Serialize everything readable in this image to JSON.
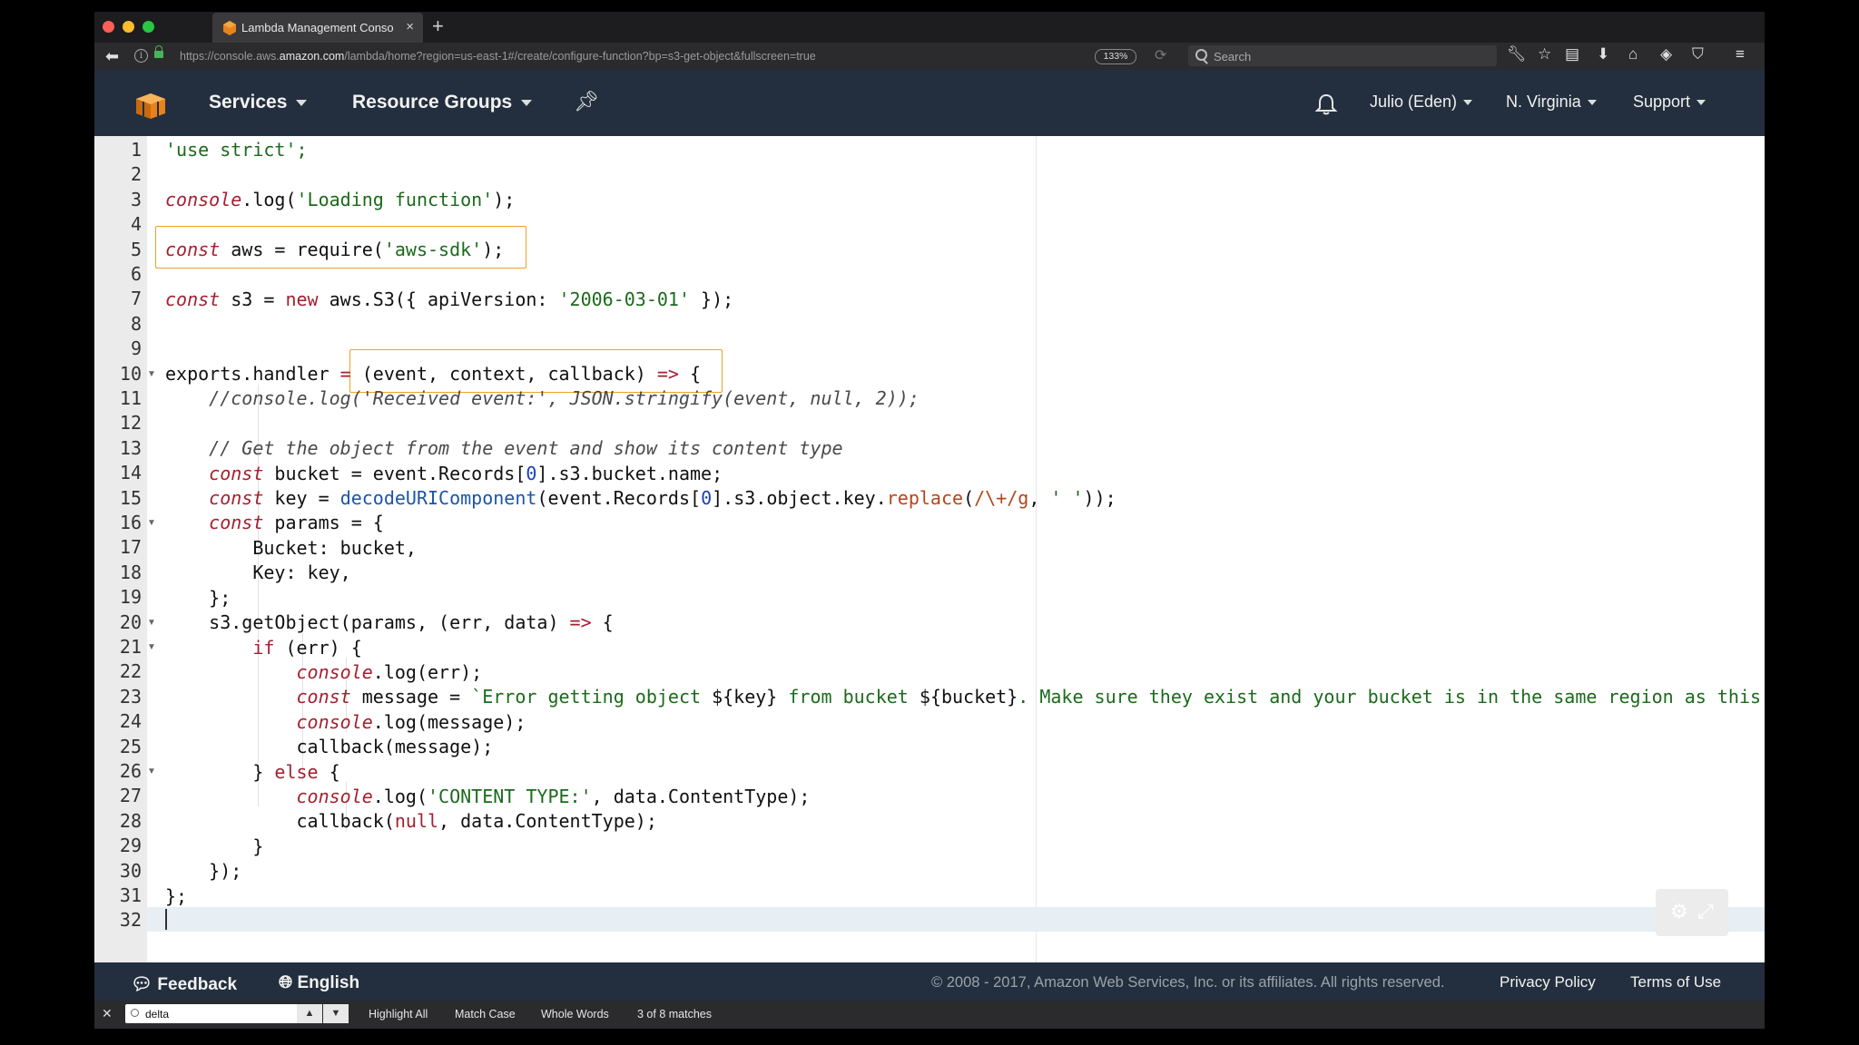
{
  "browser": {
    "tab_title": "Lambda Management Console",
    "url_prefix": "https://console.aws.",
    "url_domain": "amazon.com",
    "url_path": "/lambda/home?region=us-east-1#/create/configure-function?bp=s3-get-object&fullscreen=true",
    "zoom": "133%",
    "search_placeholder": "Search",
    "icons": [
      "wrench-icon",
      "star-icon",
      "reader-icon",
      "download-icon",
      "home-icon",
      "extension-icon",
      "pocket-icon",
      "hamburger-menu-icon"
    ]
  },
  "header": {
    "services": "Services",
    "resource_groups": "Resource Groups",
    "user": "Julio (Eden)",
    "region": "N. Virginia",
    "support": "Support"
  },
  "editor": {
    "line_numbers": [
      "1",
      "2",
      "3",
      "4",
      "5",
      "6",
      "7",
      "8",
      "9",
      "10",
      "11",
      "12",
      "13",
      "14",
      "15",
      "16",
      "17",
      "18",
      "19",
      "20",
      "21",
      "22",
      "23",
      "24",
      "25",
      "26",
      "27",
      "28",
      "29",
      "30",
      "31",
      "32"
    ],
    "fold_lines": [
      10,
      16,
      20,
      21,
      26
    ],
    "code": {
      "l1": "'use strict';",
      "l3_obj": "console",
      "l3_call": ".log(",
      "l3_str": "'Loading function'",
      "l3_end": ");",
      "l5_kw": "const",
      "l5_a": " aws = require(",
      "l5_str": "'aws-sdk'",
      "l5_end": ");",
      "l7_kw": "const",
      "l7_a": " s3 = ",
      "l7_new": "new",
      "l7_b": " aws.S3({ apiVersion: ",
      "l7_str": "'2006-03-01'",
      "l7_end": " });",
      "l10_a": "exports.handler ",
      "l10_eq": "=",
      "l10_b": " (event, context, callback) ",
      "l10_arrow": "=>",
      "l10_end": " {",
      "l11": "//console.log('Received event:', JSON.stringify(event, null, 2));",
      "l13": "// Get the object from the event and show its content type",
      "l14_kw": "const",
      "l14_a": " bucket = event.Records[",
      "l14_num": "0",
      "l14_end": "].s3.bucket.name;",
      "l15_kw": "const",
      "l15_a": " key = ",
      "l15_fn": "decodeURIComponent",
      "l15_b": "(event.Records[",
      "l15_num": "0",
      "l15_c": "].s3.object.key.",
      "l15_rep": "replace",
      "l15_d": "(",
      "l15_rx": "/\\+/g",
      "l15_e": ", ",
      "l15_str": "' '",
      "l15_end": "));",
      "l16_kw": "const",
      "l16_a": " params = {",
      "l17": "Bucket: bucket,",
      "l18": "Key: key,",
      "l19": "};",
      "l20_a": "s3.getObject(params, (err, data) ",
      "l20_arrow": "=>",
      "l20_end": " {",
      "l21_kw": "if",
      "l21_a": " (err) {",
      "l22_obj": "console",
      "l22_a": ".log(err);",
      "l23_kw": "const",
      "l23_a": " message = ",
      "l23_s1": "`Error getting object ",
      "l23_t1": "${key}",
      "l23_s2": " from bucket ",
      "l23_t2": "${bucket}",
      "l23_s3": ". Make sure they exist and your bucket is in the same region as this",
      "l24_obj": "console",
      "l24_a": ".log(message);",
      "l25": "callback(message);",
      "l26_a": "} ",
      "l26_kw": "else",
      "l26_end": " {",
      "l27_obj": "console",
      "l27_a": ".log(",
      "l27_str": "'CONTENT TYPE:'",
      "l27_end": ", data.ContentType);",
      "l28_a": "callback(",
      "l28_kw": "null",
      "l28_end": ", data.ContentType);",
      "l29": "}",
      "l30": "});",
      "l31": "};"
    }
  },
  "footer": {
    "feedback": "Feedback",
    "language": "English",
    "copyright": "© 2008 - 2017, Amazon Web Services, Inc. or its affiliates. All rights reserved.",
    "privacy": "Privacy Policy",
    "terms": "Terms of Use"
  },
  "findbar": {
    "query": "delta",
    "highlight_all": "Highlight All",
    "match_case": "Match Case",
    "whole_words": "Whole Words",
    "status": "3 of 8 matches"
  },
  "colors": {
    "aws_nav": "#232f3e",
    "highlight_box": "#f0a020",
    "keyword": "#a41f2f",
    "string": "#1b6a1b"
  }
}
